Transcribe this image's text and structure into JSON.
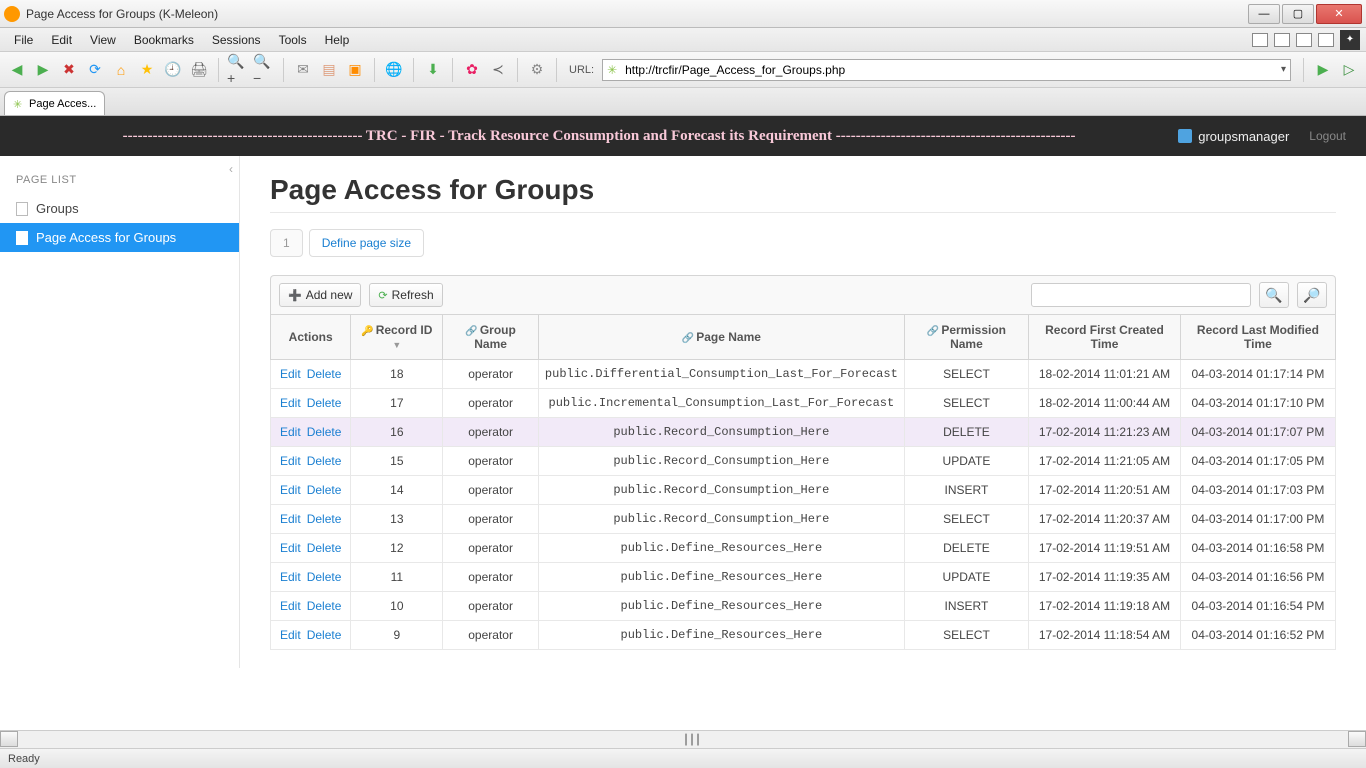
{
  "window": {
    "title": "Page Access for Groups (K-Meleon)"
  },
  "menubar": [
    "File",
    "Edit",
    "View",
    "Bookmarks",
    "Sessions",
    "Tools",
    "Help"
  ],
  "url": {
    "label": "URL:",
    "value": "http://trcfir/Page_Access_for_Groups.php"
  },
  "tab": {
    "label": "Page Acces..."
  },
  "app_header": {
    "banner_prefix": "------------------------------------------------ ",
    "banner_core": "TRC - FIR - Track Resource Consumption and Forecast its Requirement",
    "banner_suffix": " ------------------------------------------------",
    "user": "groupsmanager",
    "logout": "Logout"
  },
  "sidebar": {
    "title": "PAGE LIST",
    "items": [
      {
        "label": "Groups",
        "active": false
      },
      {
        "label": "Page Access for Groups",
        "active": true
      }
    ]
  },
  "page": {
    "heading": "Page Access for Groups",
    "pager_current": "1",
    "pager_define": "Define page size",
    "add_new": "Add new",
    "refresh": "Refresh"
  },
  "columns": [
    "Actions",
    "Record ID",
    "Group Name",
    "Page Name",
    "Permission Name",
    "Record First Created Time",
    "Record Last Modified Time"
  ],
  "action_labels": {
    "edit": "Edit",
    "delete": "Delete"
  },
  "rows": [
    {
      "id": "18",
      "group": "operator",
      "page": "public.Differential_Consumption_Last_For_Forecast",
      "perm": "SELECT",
      "created": "18-02-2014 11:01:21 AM",
      "modified": "04-03-2014 01:17:14 PM"
    },
    {
      "id": "17",
      "group": "operator",
      "page": "public.Incremental_Consumption_Last_For_Forecast",
      "perm": "SELECT",
      "created": "18-02-2014 11:00:44 AM",
      "modified": "04-03-2014 01:17:10 PM"
    },
    {
      "id": "16",
      "group": "operator",
      "page": "public.Record_Consumption_Here",
      "perm": "DELETE",
      "created": "17-02-2014 11:21:23 AM",
      "modified": "04-03-2014 01:17:07 PM"
    },
    {
      "id": "15",
      "group": "operator",
      "page": "public.Record_Consumption_Here",
      "perm": "UPDATE",
      "created": "17-02-2014 11:21:05 AM",
      "modified": "04-03-2014 01:17:05 PM"
    },
    {
      "id": "14",
      "group": "operator",
      "page": "public.Record_Consumption_Here",
      "perm": "INSERT",
      "created": "17-02-2014 11:20:51 AM",
      "modified": "04-03-2014 01:17:03 PM"
    },
    {
      "id": "13",
      "group": "operator",
      "page": "public.Record_Consumption_Here",
      "perm": "SELECT",
      "created": "17-02-2014 11:20:37 AM",
      "modified": "04-03-2014 01:17:00 PM"
    },
    {
      "id": "12",
      "group": "operator",
      "page": "public.Define_Resources_Here",
      "perm": "DELETE",
      "created": "17-02-2014 11:19:51 AM",
      "modified": "04-03-2014 01:16:58 PM"
    },
    {
      "id": "11",
      "group": "operator",
      "page": "public.Define_Resources_Here",
      "perm": "UPDATE",
      "created": "17-02-2014 11:19:35 AM",
      "modified": "04-03-2014 01:16:56 PM"
    },
    {
      "id": "10",
      "group": "operator",
      "page": "public.Define_Resources_Here",
      "perm": "INSERT",
      "created": "17-02-2014 11:19:18 AM",
      "modified": "04-03-2014 01:16:54 PM"
    },
    {
      "id": "9",
      "group": "operator",
      "page": "public.Define_Resources_Here",
      "perm": "SELECT",
      "created": "17-02-2014 11:18:54 AM",
      "modified": "04-03-2014 01:16:52 PM"
    }
  ],
  "status": "Ready"
}
